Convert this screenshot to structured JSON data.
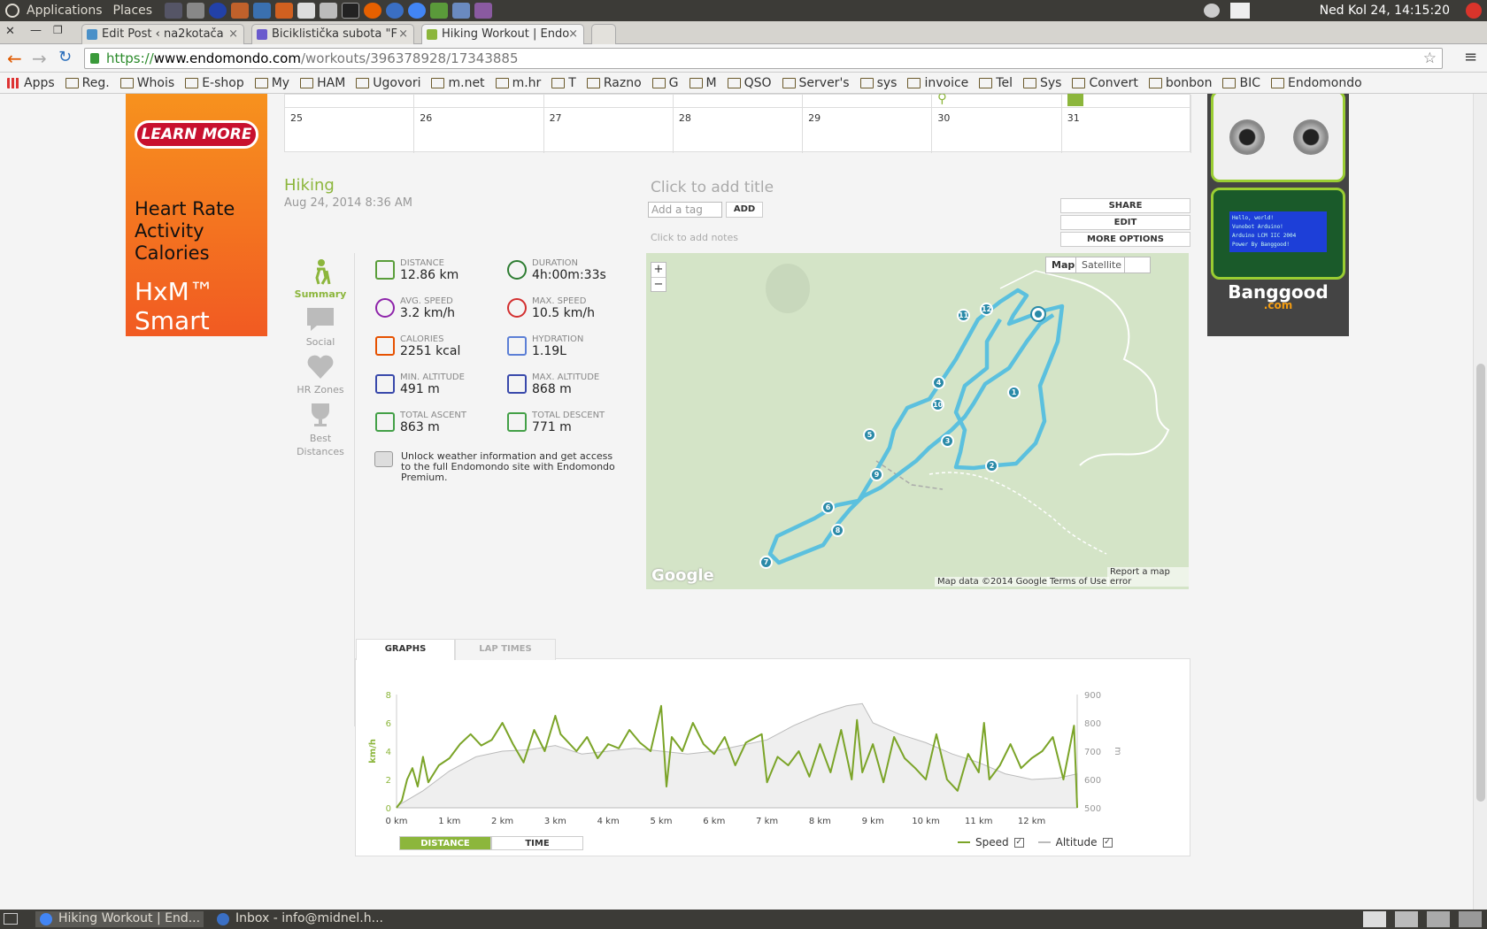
{
  "system": {
    "menu": [
      "Applications",
      "Places"
    ],
    "clock": "Ned Kol 24, 14:15:20",
    "taskbar": [
      "Hiking Workout | End...",
      "Inbox - info@midnel.h..."
    ]
  },
  "tabs": [
    {
      "label": "Edit Post ‹ na2kotača",
      "color": "#4a90c8"
    },
    {
      "label": "Biciklistička subota \"F",
      "color": "#6a5acd"
    },
    {
      "label": "Hiking Workout | Endo",
      "color": "#8cb63c"
    }
  ],
  "url": {
    "scheme": "https://",
    "host": "www.endomondo.com",
    "path": "/workouts/396378928/17343885"
  },
  "bookmarks": [
    "Apps",
    "Reg.",
    "Whois",
    "E-shop",
    "My",
    "HAM",
    "Ugovori",
    "m.net",
    "m.hr",
    "T",
    "Razno",
    "G",
    "M",
    "QSO",
    "Server's",
    "sys",
    "invoice",
    "Tel",
    "Sys",
    "Convert",
    "bonbon",
    "BIC",
    "Endomondo"
  ],
  "ad_left": {
    "button": "LEARN MORE",
    "lines": [
      "Heart Rate",
      "Activity",
      "Calories"
    ],
    "product": "HxM™ Smart"
  },
  "ad_right": {
    "brand": "Banggood",
    "tld": ".com",
    "lcd": [
      "Hello, world!",
      "Vunobot Arduino!",
      "Arduino LCM IIC 2004",
      "Power By Banggood!"
    ]
  },
  "calendar": [
    "25",
    "26",
    "27",
    "28",
    "29",
    "30",
    "31"
  ],
  "workout": {
    "sport": "Hiking",
    "date": "Aug 24, 2014 8:36 AM",
    "add_title": "Click to add title",
    "tag_placeholder": "Add a tag",
    "add_btn": "ADD",
    "notes": "Click to add notes",
    "actions": [
      "SHARE",
      "EDIT",
      "MORE OPTIONS"
    ]
  },
  "nav": [
    {
      "label": "Summary",
      "active": true
    },
    {
      "label": "Social",
      "active": false
    },
    {
      "label": "HR Zones",
      "active": false
    },
    {
      "label": "Best Distances",
      "active": false
    }
  ],
  "stats": [
    {
      "label": "DISTANCE",
      "value": "12.86 km",
      "icon": "ruler-icon",
      "color": "#5a9e3a"
    },
    {
      "label": "DURATION",
      "value": "4h:00m:33s",
      "icon": "stopwatch-icon",
      "color": "#2e7d32"
    },
    {
      "label": "AVG. SPEED",
      "value": "3.2 km/h",
      "icon": "gauge-icon",
      "color": "#8e24aa"
    },
    {
      "label": "MAX. SPEED",
      "value": "10.5 km/h",
      "icon": "gauge-max-icon",
      "color": "#d32f2f"
    },
    {
      "label": "CALORIES",
      "value": "2251 kcal",
      "icon": "flame-icon",
      "color": "#e65100"
    },
    {
      "label": "HYDRATION",
      "value": "1.19L",
      "icon": "drops-icon",
      "color": "#5c7fd6"
    },
    {
      "label": "MIN. ALTITUDE",
      "value": "491 m",
      "icon": "mountain-icon",
      "color": "#3949ab"
    },
    {
      "label": "MAX. ALTITUDE",
      "value": "868 m",
      "icon": "mountain-icon",
      "color": "#3949ab"
    },
    {
      "label": "TOTAL ASCENT",
      "value": "863 m",
      "icon": "ascent-icon",
      "color": "#43a047"
    },
    {
      "label": "TOTAL DESCENT",
      "value": "771 m",
      "icon": "descent-icon",
      "color": "#43a047"
    }
  ],
  "weather_note": "Unlock weather information and get access to the full Endomondo site with Endomondo Premium.",
  "map": {
    "types": [
      "Map",
      "Satellite"
    ],
    "zoom_in": "+",
    "zoom_out": "−",
    "credits": [
      "Map data ©2014 Google",
      "Terms of Use",
      "Report a map error"
    ],
    "logo": "Google",
    "markers": [
      "1",
      "2",
      "3",
      "4",
      "5",
      "6",
      "7",
      "8",
      "9",
      "10",
      "11",
      "12"
    ],
    "route_color": "#5bc0de"
  },
  "graph_tabs": [
    "GRAPHS",
    "LAP TIMES"
  ],
  "graph_toggle": [
    "DISTANCE",
    "TIME"
  ],
  "chart_data": {
    "type": "line",
    "x_ticks": [
      "0 km",
      "1 km",
      "2 km",
      "3 km",
      "4 km",
      "5 km",
      "6 km",
      "7 km",
      "8 km",
      "9 km",
      "10 km",
      "11 km",
      "12 km"
    ],
    "ylabel": "km/h",
    "y2label": "m",
    "ylim": [
      0,
      8
    ],
    "y2lim": [
      500,
      900
    ],
    "y_ticks": [
      "0",
      "2",
      "4",
      "6",
      "8"
    ],
    "y2_ticks": [
      "500",
      "600",
      "700",
      "800",
      "900"
    ],
    "xlim": [
      0,
      12.86
    ],
    "series": [
      {
        "name": "Speed",
        "color": "#7ba428",
        "x": [
          0,
          0.1,
          0.2,
          0.3,
          0.4,
          0.5,
          0.6,
          0.8,
          1.0,
          1.2,
          1.4,
          1.6,
          1.8,
          2.0,
          2.2,
          2.4,
          2.6,
          2.8,
          3.0,
          3.1,
          3.2,
          3.4,
          3.6,
          3.8,
          4.0,
          4.2,
          4.4,
          4.6,
          4.8,
          5.0,
          5.1,
          5.2,
          5.4,
          5.6,
          5.8,
          6.0,
          6.2,
          6.4,
          6.6,
          6.8,
          6.9,
          7.0,
          7.2,
          7.4,
          7.6,
          7.8,
          8.0,
          8.2,
          8.4,
          8.6,
          8.7,
          8.8,
          9.0,
          9.2,
          9.4,
          9.6,
          9.8,
          10.0,
          10.2,
          10.4,
          10.6,
          10.8,
          11.0,
          11.1,
          11.2,
          11.4,
          11.6,
          11.8,
          12.0,
          12.2,
          12.4,
          12.6,
          12.8,
          12.86
        ],
        "values": [
          0,
          0.5,
          2.0,
          2.8,
          1.5,
          3.6,
          1.8,
          3.0,
          3.5,
          4.5,
          5.2,
          4.4,
          4.8,
          6.0,
          4.5,
          3.2,
          5.5,
          4.0,
          6.5,
          5.2,
          4.8,
          4.0,
          5.0,
          3.5,
          4.5,
          4.2,
          5.5,
          4.6,
          4.0,
          7.2,
          1.5,
          5.0,
          4.0,
          6.0,
          4.5,
          3.8,
          5.0,
          3.0,
          4.6,
          5.0,
          5.2,
          1.8,
          3.6,
          3.0,
          4.0,
          2.2,
          4.5,
          2.5,
          5.5,
          2.0,
          6.2,
          2.5,
          4.5,
          1.8,
          5.0,
          3.5,
          2.8,
          2.0,
          5.2,
          2.0,
          1.2,
          3.8,
          2.5,
          6.0,
          2.0,
          3.0,
          4.5,
          2.8,
          3.5,
          4.0,
          5.0,
          2.0,
          5.8,
          0
        ]
      },
      {
        "name": "Altitude",
        "color": "#bbbbbb",
        "x": [
          0,
          0.5,
          1.0,
          1.5,
          2.0,
          2.5,
          3.0,
          3.5,
          4.0,
          4.5,
          5.0,
          5.5,
          6.0,
          6.5,
          7.0,
          7.5,
          8.0,
          8.5,
          8.8,
          9.0,
          9.5,
          10.0,
          10.5,
          11.0,
          11.5,
          12.0,
          12.5,
          12.86
        ],
        "values": [
          505,
          560,
          630,
          680,
          700,
          705,
          720,
          690,
          700,
          710,
          700,
          690,
          700,
          720,
          740,
          790,
          830,
          860,
          868,
          800,
          760,
          730,
          690,
          660,
          620,
          600,
          605,
          620
        ]
      }
    ],
    "legend": "bottom-right"
  }
}
